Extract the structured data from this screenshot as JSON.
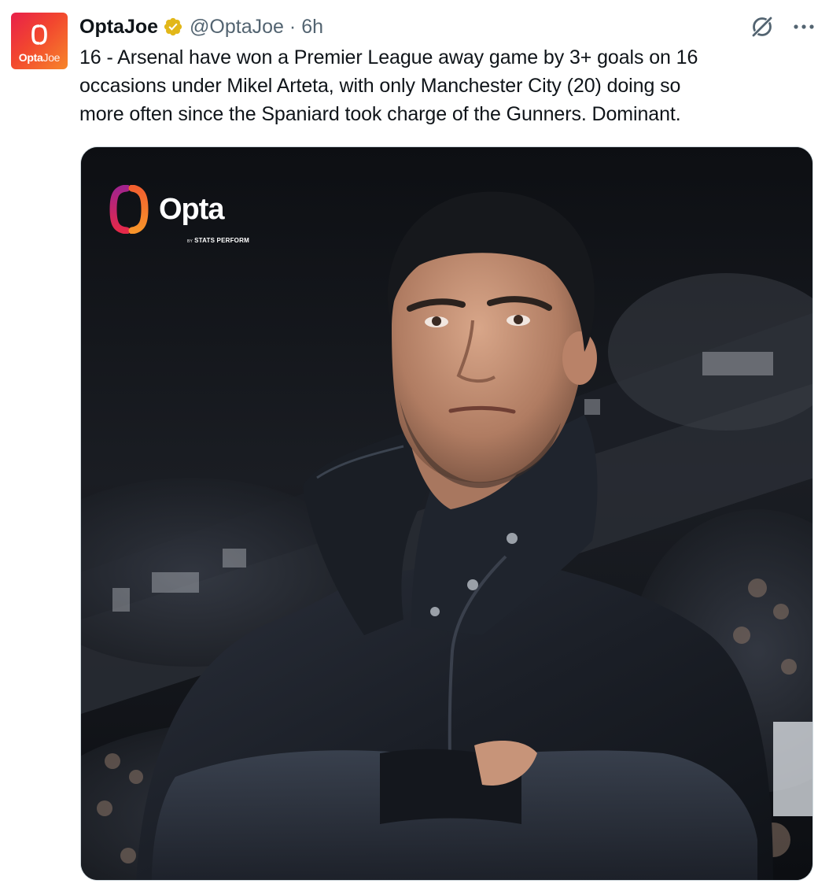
{
  "account": {
    "display_name": "OptaJoe",
    "handle": "@OptaJoe",
    "separator": "·",
    "time": "6h",
    "avatar": {
      "text_bold": "Opta",
      "text_light": "Joe"
    }
  },
  "tweet": {
    "text": "16 - Arsenal have won a Premier League away game by 3+ goals on 16\noccasions under Mikel Arteta, with only Manchester City (20) doing so\nmore often since the Spaniard took charge of the Gunners. Dominant."
  },
  "media": {
    "brand_word": "Opta",
    "brand_by": "BY",
    "brand_sub": "STATS PERFORM"
  },
  "icons": {
    "verified": "verified-badge-icon",
    "grok": "grok-icon",
    "more": "more-options-icon"
  },
  "colors": {
    "verified_gold": "#e2b719",
    "secondary_text": "#536471",
    "avatar_start": "#e8204a",
    "avatar_end": "#f7862a"
  }
}
